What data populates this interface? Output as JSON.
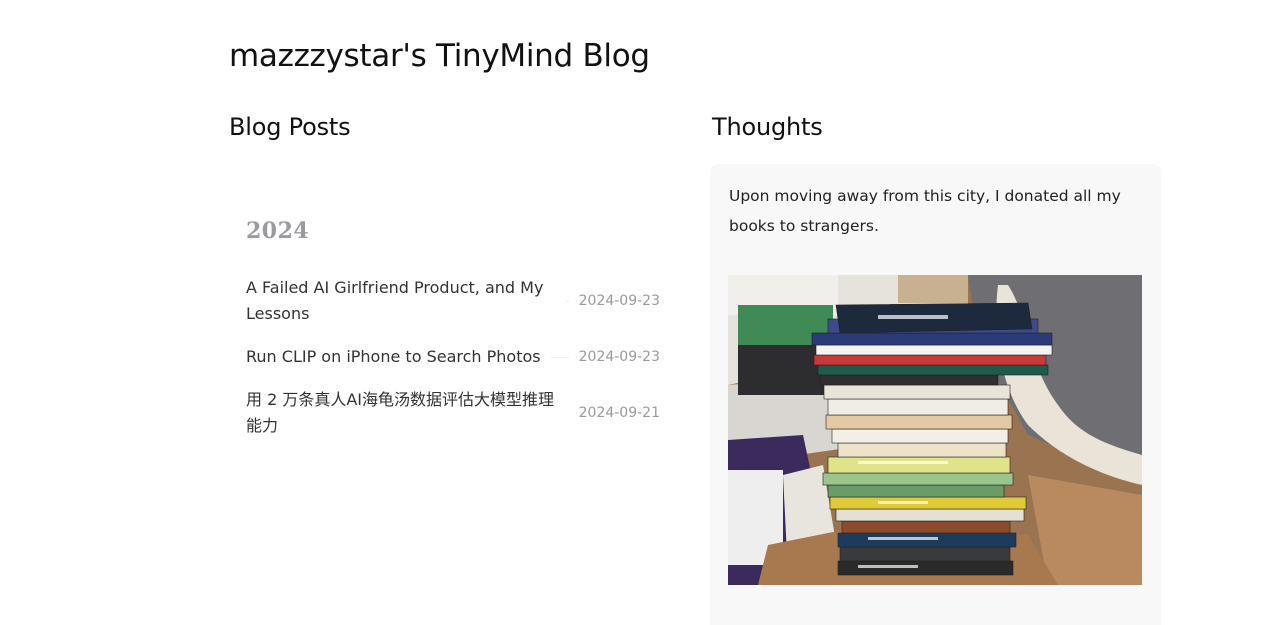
{
  "site": {
    "title": "mazzzystar's TinyMind Blog"
  },
  "blog_posts": {
    "heading": "Blog Posts",
    "groups": [
      {
        "year": "2024",
        "posts": [
          {
            "title": "A Failed AI Girlfriend Product, and My Lessons",
            "date": "2024-09-23"
          },
          {
            "title": "Run CLIP on iPhone to Search Photos",
            "date": "2024-09-23"
          },
          {
            "title": "用 2 万条真人AI海龟汤数据评估大模型推理能力",
            "date": "2024-09-21"
          }
        ]
      }
    ]
  },
  "thoughts": {
    "heading": "Thoughts",
    "items": [
      {
        "text": "Upon moving away from this city, I donated all my books to strangers.",
        "image": {
          "subject": "stack-of-books-photo"
        }
      }
    ]
  }
}
